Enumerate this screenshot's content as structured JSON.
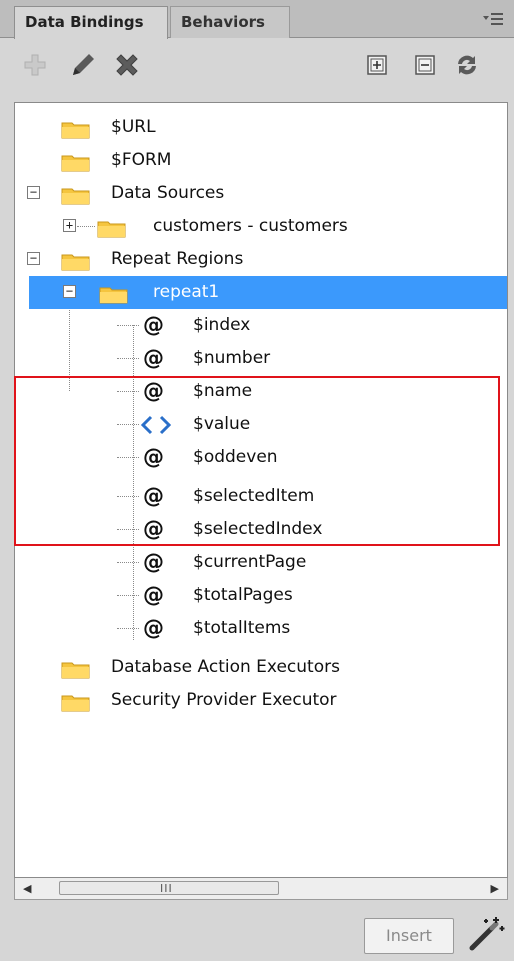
{
  "tabs": [
    {
      "label": "Data Bindings",
      "active": true
    },
    {
      "label": "Behaviors",
      "active": false
    }
  ],
  "toolbar": {
    "icons": [
      "add-icon",
      "edit-icon",
      "delete-icon",
      "expand-all-icon",
      "collapse-all-icon",
      "refresh-icon"
    ]
  },
  "tree": {
    "items": [
      {
        "label": "$URL",
        "type": "folder",
        "level": 0
      },
      {
        "label": "$FORM",
        "type": "folder",
        "level": 0
      },
      {
        "label": "Data Sources",
        "type": "folder",
        "level": 0,
        "expanded": true
      },
      {
        "label": "customers - customers",
        "type": "folder",
        "level": 1,
        "expanded": false
      },
      {
        "label": "Repeat Regions",
        "type": "folder",
        "level": 0,
        "expanded": true
      },
      {
        "label": "repeat1",
        "type": "folder",
        "level": 1,
        "expanded": true,
        "selected": true
      },
      {
        "label": "$index",
        "type": "at",
        "level": 2
      },
      {
        "label": "$number",
        "type": "at",
        "level": 2
      },
      {
        "label": "$name",
        "type": "at",
        "level": 2
      },
      {
        "label": "$value",
        "type": "code",
        "level": 2
      },
      {
        "label": "$oddeven",
        "type": "at",
        "level": 2
      },
      {
        "label": "$selectedItem",
        "type": "at",
        "level": 2
      },
      {
        "label": "$selectedIndex",
        "type": "at",
        "level": 2
      },
      {
        "label": "$currentPage",
        "type": "at",
        "level": 2
      },
      {
        "label": "$totalPages",
        "type": "at",
        "level": 2
      },
      {
        "label": "$totalItems",
        "type": "at",
        "level": 2
      },
      {
        "label": "Database Action Executors",
        "type": "folder",
        "level": 0
      },
      {
        "label": "Security Provider Executor",
        "type": "folder",
        "level": 0
      }
    ],
    "expander_collapsed": "+",
    "expander_expanded": "−",
    "at_symbol": "@"
  },
  "scrollbar": {
    "grip": "III",
    "left_arrow": "◀",
    "right_arrow": "▶"
  },
  "footer": {
    "insert_label": "Insert",
    "insert_enabled": false
  },
  "colors": {
    "selection": "#3b99fc",
    "highlight_border": "#e0131a",
    "folder": "#f5c53f"
  }
}
